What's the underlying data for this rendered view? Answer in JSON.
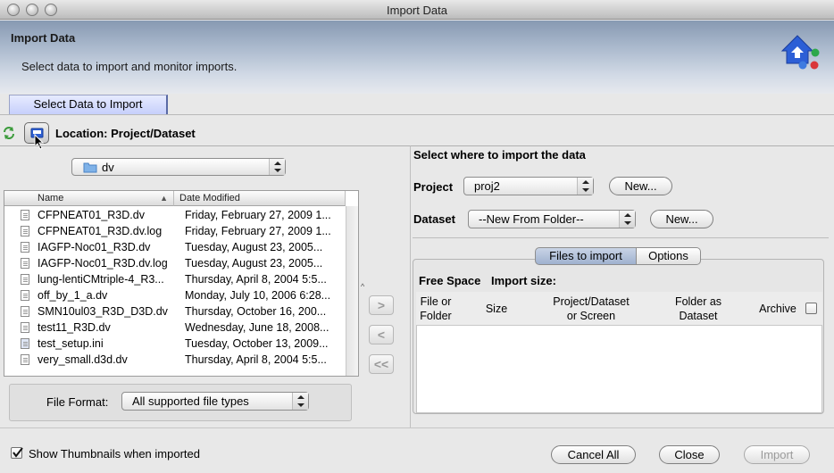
{
  "window": {
    "title": "Import Data"
  },
  "header": {
    "title": "Import Data",
    "subtitle": "Select data to import and monitor imports."
  },
  "tabs": [
    {
      "label": "Select Data to Import",
      "selected": true
    }
  ],
  "toolbar": {
    "location_label": "Location: Project/Dataset"
  },
  "folder": {
    "selected": "dv"
  },
  "file_table": {
    "columns": [
      "Name",
      "Date Modified"
    ],
    "rows": [
      {
        "name": "CFPNEAT01_R3D.dv",
        "date": "Friday, February 27, 2009 1...",
        "icon": "document-icon"
      },
      {
        "name": "CFPNEAT01_R3D.dv.log",
        "date": "Friday, February 27, 2009 1...",
        "icon": "document-icon"
      },
      {
        "name": "IAGFP-Noc01_R3D.dv",
        "date": "Tuesday, August 23, 2005...",
        "icon": "document-icon"
      },
      {
        "name": "IAGFP-Noc01_R3D.dv.log",
        "date": "Tuesday, August 23, 2005...",
        "icon": "document-icon"
      },
      {
        "name": "lung-lentiCMtriple-4_R3...",
        "date": "Thursday, April 8, 2004 5:5...",
        "icon": "document-icon"
      },
      {
        "name": "off_by_1_a.dv",
        "date": "Monday, July 10, 2006 6:28...",
        "icon": "document-icon"
      },
      {
        "name": "SMN10ul03_R3D_D3D.dv",
        "date": "Thursday, October 16, 200...",
        "icon": "document-icon"
      },
      {
        "name": "test11_R3D.dv",
        "date": "Wednesday, June 18, 2008...",
        "icon": "document-icon"
      },
      {
        "name": "test_setup.ini",
        "date": "Tuesday, October 13, 2009...",
        "icon": "settings-file-icon"
      },
      {
        "name": "very_small.d3d.dv",
        "date": "Thursday, April 8, 2004 5:5...",
        "icon": "document-icon"
      }
    ]
  },
  "file_format": {
    "label": "File Format:",
    "selected": "All supported file types"
  },
  "target": {
    "heading": "Select where to import the data",
    "project_label": "Project",
    "project_value": "proj2",
    "project_new": "New...",
    "dataset_label": "Dataset",
    "dataset_value": "--New From Folder--",
    "dataset_new": "New..."
  },
  "right_tabs": [
    {
      "label": "Files to import",
      "selected": true
    },
    {
      "label": "Options",
      "selected": false
    }
  ],
  "import_info": {
    "free_space": "Free Space",
    "import_size": "Import size:"
  },
  "import_table": {
    "col1": [
      "File or",
      "Folder"
    ],
    "col2": "Size",
    "col3": [
      "Project/Dataset",
      "or Screen"
    ],
    "col4": [
      "Folder as",
      "Dataset"
    ],
    "col5": "Archive"
  },
  "thumbnails": {
    "label": "Show Thumbnails when imported",
    "checked": true
  },
  "buttons": {
    "cancel_all": "Cancel All",
    "close": "Close",
    "import": "Import"
  },
  "colors": {
    "tab": "#c9d2fb",
    "header": "#a9b8cc"
  }
}
